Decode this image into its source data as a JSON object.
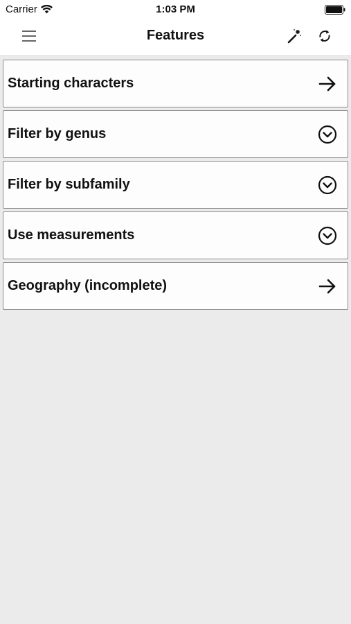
{
  "status_bar": {
    "carrier": "Carrier",
    "time": "1:03 PM",
    "wifi_icon": "wifi-icon",
    "battery_icon": "battery-icon"
  },
  "nav": {
    "title": "Features",
    "menu_icon": "hamburger-menu-icon",
    "wand_icon": "magic-wand-icon",
    "refresh_icon": "refresh-icon"
  },
  "features": [
    {
      "label": "Starting characters",
      "icon": "arrow-right-icon"
    },
    {
      "label": "Filter by genus",
      "icon": "chevron-down-circle-icon"
    },
    {
      "label": "Filter by subfamily",
      "icon": "chevron-down-circle-icon"
    },
    {
      "label": "Use measurements",
      "icon": "chevron-down-circle-icon"
    },
    {
      "label": "Geography (incomplete)",
      "icon": "arrow-right-icon"
    }
  ],
  "colors": {
    "background": "#ebebeb",
    "row_background": "#fdfdfd",
    "row_border": "#8a8a8a",
    "text": "#111111"
  }
}
